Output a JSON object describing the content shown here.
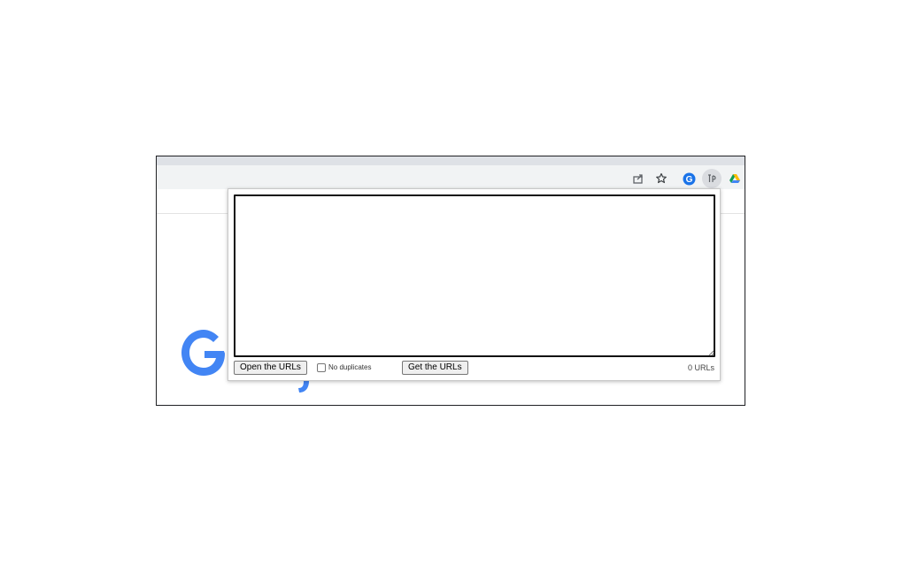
{
  "toolbar": {
    "icons": [
      "share-icon",
      "star-icon",
      "extension-g-icon",
      "url-extension-icon",
      "drive-icon"
    ],
    "extension_badge": "G"
  },
  "popup": {
    "textarea_value": "",
    "open_button_label": "Open the URLs",
    "no_duplicates_label": "No duplicates",
    "no_duplicates_checked": false,
    "get_button_label": "Get the URLs",
    "url_count": "0 URLs"
  },
  "colors": {
    "google_blue": "#4285f4",
    "frame_border": "#202124",
    "toolbar_bg": "#f1f3f4"
  }
}
